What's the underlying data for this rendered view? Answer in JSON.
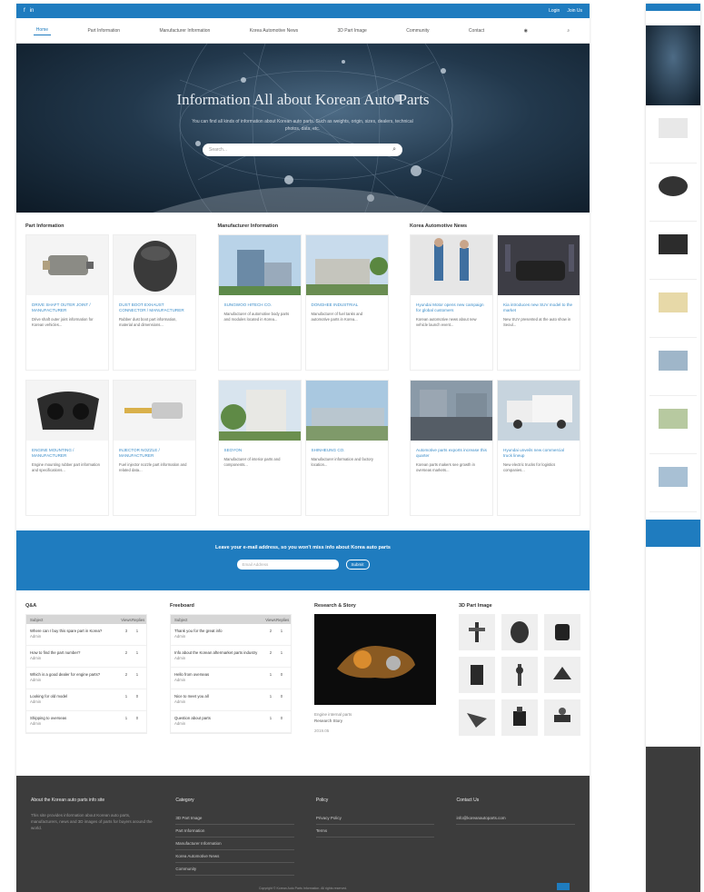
{
  "topbar": {
    "social": [
      "f",
      "in"
    ],
    "links": [
      "Login",
      "Join Us"
    ]
  },
  "nav": {
    "items": [
      "Home",
      "Part Information",
      "Manufacturer Information",
      "Korea Automotive News",
      "3D Part Image",
      "Community",
      "Contact"
    ]
  },
  "hero": {
    "title": "Information All about Korean Auto Parts",
    "subtitle": "You can find all kinds of information about Korean auto parts. Such as weights, origin, sizes, dealers, technical photos, data, etc.",
    "search_placeholder": "Search..."
  },
  "sections": {
    "parts": {
      "title": "Part Information",
      "cards": [
        {
          "title": "DRIVE SHAFT OUTER JOINT / MANUFACTURER",
          "desc": "Drive shaft outer joint information for Korean vehicles..."
        },
        {
          "title": "DUST BOOT EXHAUST CONNECTOR / MANUFACTURER",
          "desc": "Rubber dust boot part information, material and dimensions..."
        },
        {
          "title": "ENGINE MOUNTING / MANUFACTURER",
          "desc": "Engine mounting rubber part information and specifications..."
        },
        {
          "title": "INJECTOR NOZZLE / MANUFACTURER",
          "desc": "Fuel injector nozzle part information and related data..."
        }
      ]
    },
    "manufacturers": {
      "title": "Manufacturer Information",
      "cards": [
        {
          "title": "SUNGWOO HITECH CO.",
          "desc": "Manufacturer of automotive body parts and modules located in Korea..."
        },
        {
          "title": "DONGHEE INDUSTRIAL",
          "desc": "Manufacturer of fuel tanks and automotive parts in Korea..."
        },
        {
          "title": "SEOYON",
          "desc": "Manufacturer of interior parts and components..."
        },
        {
          "title": "SHINHEUNG CO.",
          "desc": "Manufacturer information and factory location..."
        }
      ]
    },
    "news": {
      "title": "Korea Automotive News",
      "cards": [
        {
          "title": "Hyundai Motor opens new campaign for global customers",
          "desc": "Korean automotive news about new vehicle launch event..."
        },
        {
          "title": "Kia introduces new SUV model to the market",
          "desc": "New SUV presented at the auto show in Seoul..."
        },
        {
          "title": "Automotive parts exports increase this quarter",
          "desc": "Korean parts makers see growth in overseas markets..."
        },
        {
          "title": "Hyundai unveils new commercial truck lineup",
          "desc": "New electric trucks for logistics companies..."
        }
      ]
    }
  },
  "newsletter": {
    "text": "Leave your e-mail address, so you won't miss info about Korea auto parts",
    "placeholder": "Email Address",
    "button": "Submit"
  },
  "qa": {
    "title": "Q&A",
    "headers": [
      "Subject",
      "Views",
      "Replies"
    ],
    "rows": [
      {
        "q": "Where can I buy this spare part in Korea?",
        "a": "Admin",
        "v": "3",
        "r": "1"
      },
      {
        "q": "How to find the part number?",
        "a": "Admin",
        "v": "2",
        "r": "1"
      },
      {
        "q": "Which is a good dealer for engine parts?",
        "a": "Admin",
        "v": "2",
        "r": "1"
      },
      {
        "q": "Looking for old model",
        "a": "Admin",
        "v": "1",
        "r": "0"
      },
      {
        "q": "Shipping to overseas",
        "a": "Admin",
        "v": "1",
        "r": "0"
      }
    ]
  },
  "freeboard": {
    "title": "Freeboard",
    "headers": [
      "Subject",
      "Views",
      "Replies"
    ],
    "rows": [
      {
        "q": "Thank you for the great info",
        "a": "Admin",
        "v": "2",
        "r": "1"
      },
      {
        "q": "Info about the Korean aftermarket parts industry",
        "a": "Admin",
        "v": "2",
        "r": "1"
      },
      {
        "q": "Hello from overseas",
        "a": "Admin",
        "v": "1",
        "r": "0"
      },
      {
        "q": "Nice to meet you all",
        "a": "Admin",
        "v": "1",
        "r": "0"
      },
      {
        "q": "Question about parts",
        "a": "Admin",
        "v": "1",
        "r": "0"
      }
    ]
  },
  "research": {
    "title": "Research & Story",
    "caption": "Engine internal parts",
    "sub": "Research Story",
    "date": "2019.05"
  },
  "gallery": {
    "title": "3D Part Image",
    "count": 9
  },
  "footer": {
    "about_title": "About the Korean auto parts info site",
    "about_text": "This site provides information about Korean auto parts, manufacturers, news and 3D images of parts for buyers around the world.",
    "cat_title": "Category",
    "cat_items": [
      "3D Part Image",
      "Part Information",
      "Manufacturer Information",
      "Korea Automotive News",
      "Community"
    ],
    "policy_title": "Policy",
    "policy_items": [
      "Privacy Policy",
      "Terms"
    ],
    "contact_title": "Contact Us",
    "contact_text": "info@koreanautoparts.com",
    "copyright": "Copyright © Korean Auto Parts Information. All rights reserved."
  },
  "colors": {
    "accent": "#1f7cbf",
    "footer": "#3c3c3c"
  }
}
